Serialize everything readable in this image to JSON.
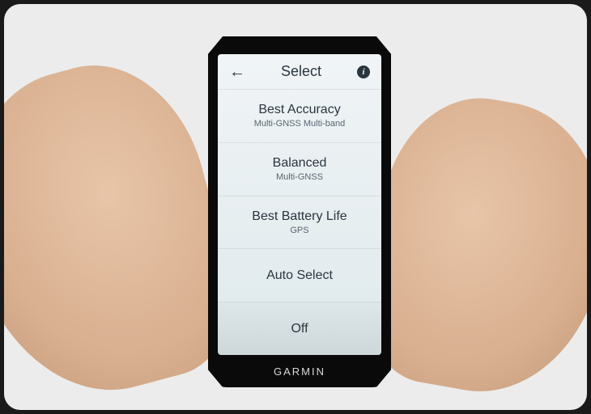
{
  "header": {
    "title": "Select"
  },
  "menu": {
    "items": [
      {
        "title": "Best Accuracy",
        "subtitle": "Multi-GNSS Multi-band"
      },
      {
        "title": "Balanced",
        "subtitle": "Multi-GNSS"
      },
      {
        "title": "Best Battery Life",
        "subtitle": "GPS"
      },
      {
        "title": "Auto Select",
        "subtitle": ""
      },
      {
        "title": "Off",
        "subtitle": ""
      }
    ]
  },
  "brand": "GARMIN"
}
